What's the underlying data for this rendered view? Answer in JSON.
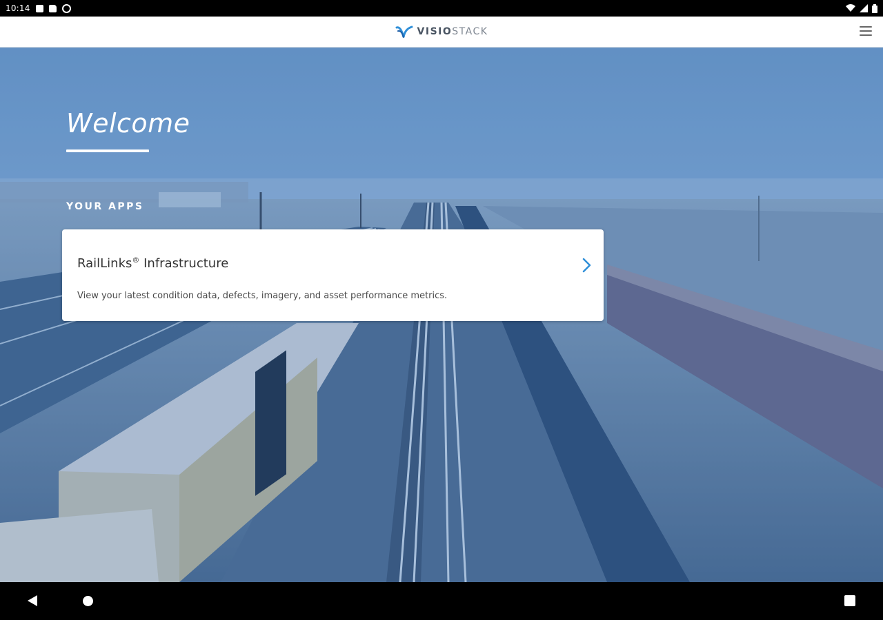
{
  "status_bar": {
    "time": "10:14"
  },
  "header": {
    "brand_part1": "VISIO",
    "brand_part2": "STACK",
    "logo_icon": "visiostack-logo-icon",
    "menu_icon": "hamburger-menu-icon"
  },
  "hero": {
    "welcome": "Welcome",
    "apps_label": "YOUR APPS"
  },
  "apps": [
    {
      "title": "RailLinks",
      "title_mark": "®",
      "title_suffix": " Infrastructure",
      "description": "View your latest condition data, defects, imagery, and asset performance metrics.",
      "icon": "chevron-right-icon"
    }
  ],
  "colors": {
    "accent": "#2f8fd8",
    "header_bg": "#ffffff",
    "hero_tint": "#4f86c6"
  }
}
